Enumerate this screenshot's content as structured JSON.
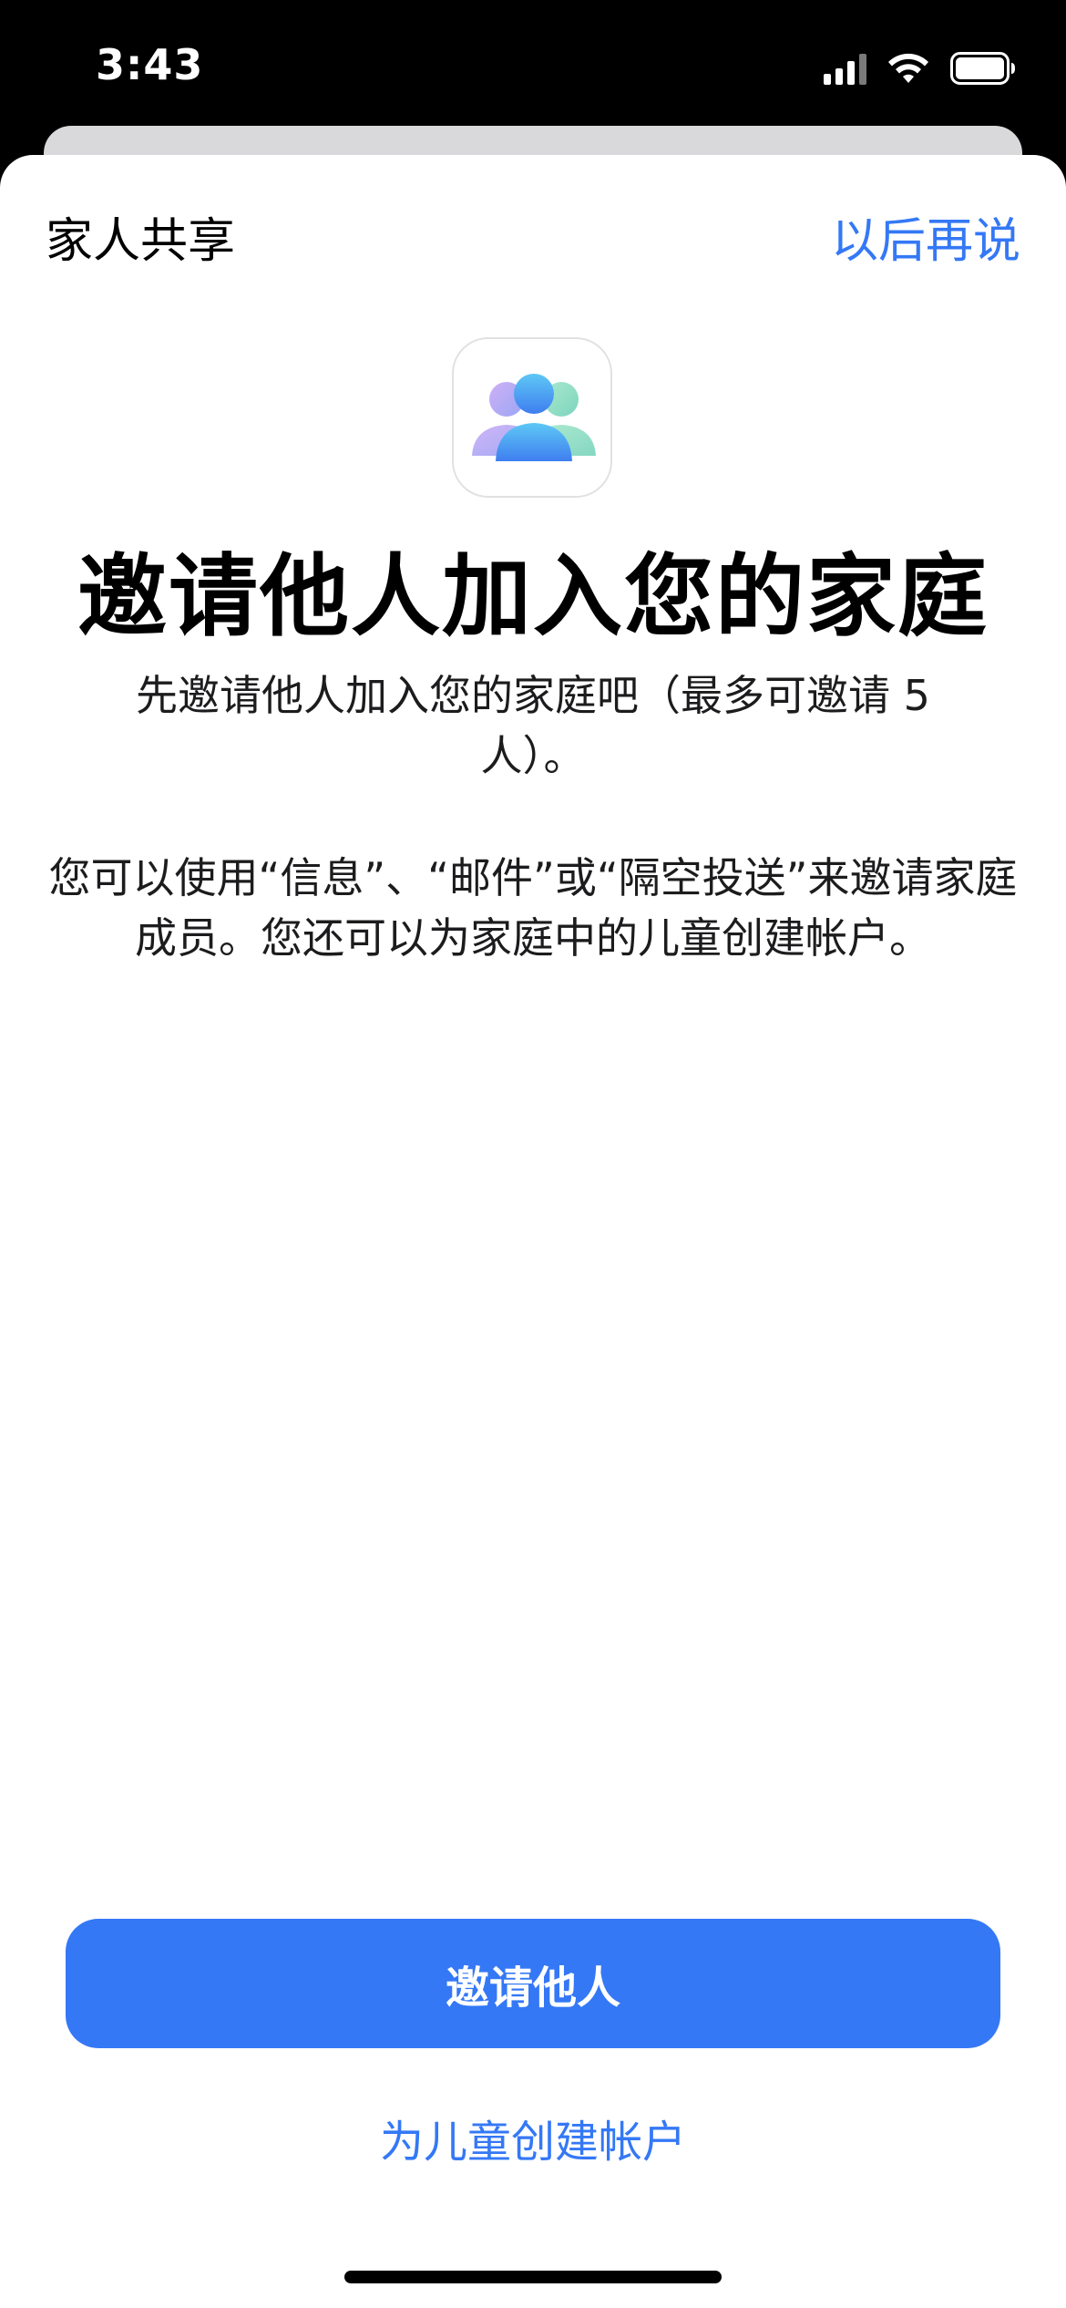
{
  "status_bar": {
    "time": "3:43",
    "icons": [
      "cellular-signal-icon",
      "wifi-icon",
      "battery-icon"
    ]
  },
  "sheet": {
    "title": "家人共享",
    "later_label": "以后再说",
    "app_icon": "family-sharing-icon",
    "headline": "邀请他人加入您的家庭",
    "subtitle": "先邀请他人加入您的家庭吧（最多可邀请 5 人）。",
    "body": "您可以使用“信息”、“邮件”或“隔空投送”来邀请家庭成员。您还可以为家庭中的儿童创建帐户。",
    "primary_button_label": "邀请他人",
    "secondary_button_label": "为儿童创建帐户"
  },
  "colors": {
    "accent": "#3478f6",
    "background": "#ffffff",
    "status_bar_background": "#000000"
  }
}
